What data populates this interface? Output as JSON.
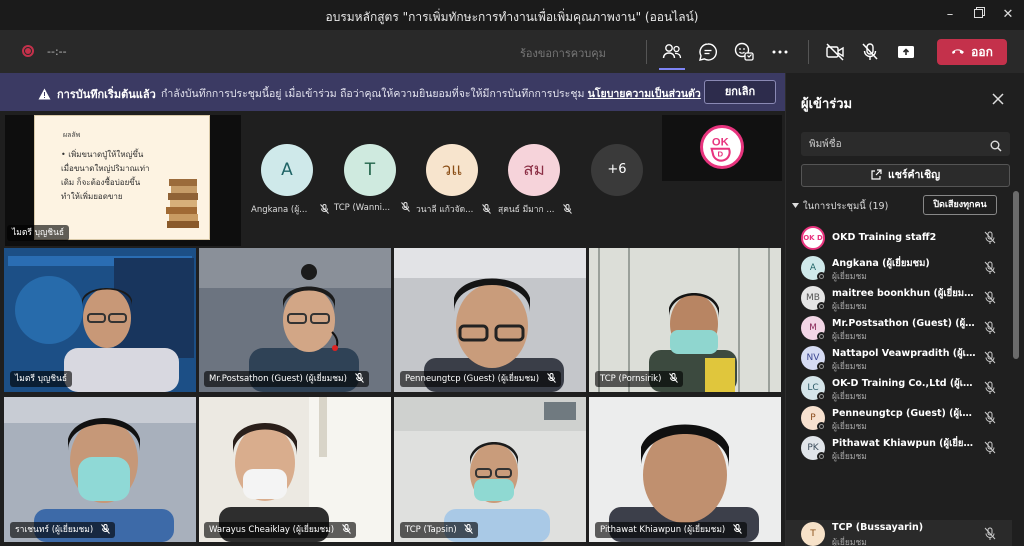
{
  "window": {
    "title": "อบรมหลักสูตร \"การเพิ่มทักษะการทำงานเพื่อเพิ่มคุณภาพงาน\" (ออนไลน์)"
  },
  "toolbar": {
    "timer": "--:--",
    "request_control": "ร้องขอการควบคุม",
    "leave_label": "ออก"
  },
  "banner": {
    "title": "การบันทึกเริ่มต้นแล้ว",
    "message": "กำลังบันทึกการประชุมนี้อยู่ เมื่อเข้าร่วม ถือว่าคุณให้ความยินยอมที่จะให้มีการบันทึกการประชุม",
    "link": "นโยบายความเป็นส่วนตัว",
    "cancel_label": "ยกเลิก"
  },
  "stage": {
    "share": {
      "presenter": "ไมตรี บุญชินธ์",
      "slide_heading": "ผลลัพ",
      "slide_lines": [
        "• เพิ่มขนาดปู่ให้ใหญ่ขึ้น",
        "เมื่อขนาดใหญ่ปริมาณเท่า",
        "เดิม ก็จะต้องซื้อบ่อยขึ้น",
        "ทำให้เพิ่มยอดขาย"
      ]
    },
    "avatars": [
      {
        "initials": "A",
        "name": "Angkana (ผู้...",
        "bg": "#cfe9ea",
        "fg": "#1f6466"
      },
      {
        "initials": "T",
        "name": "TCP (Wanni...",
        "bg": "#cfeadf",
        "fg": "#22644a"
      },
      {
        "initials": "วแ",
        "name": "วนาลี แก้วจัด...",
        "bg": "#f7e4cd",
        "fg": "#8a4d15"
      },
      {
        "initials": "สม",
        "name": "สุคนธ์ มีมาก ...",
        "bg": "#f6d3da",
        "fg": "#8b2f45"
      },
      {
        "initials": "+6",
        "name": "",
        "bg": "#3a3a3a",
        "fg": "#ffffff"
      }
    ],
    "okd_logo": "OK D",
    "tiles": [
      {
        "name": "ไมตรี บุญชินธ์"
      },
      {
        "name": "Mr.Postsathon (Guest) (ผู้เยี่ยมชม)"
      },
      {
        "name": "Penneungtcp (Guest) (ผู้เยี่ยมชม)"
      },
      {
        "name": "TCP (Pornsirik)"
      },
      {
        "name": "ราเชนทร์ (ผู้เยี่ยมชม)"
      },
      {
        "name": "Warayus Cheaiklay (ผู้เยี่ยมชม)"
      },
      {
        "name": "TCP (Tapsin)"
      },
      {
        "name": "Pithawat Khiawpun (ผู้เยี่ยมชม)"
      }
    ]
  },
  "panel": {
    "title": "ผู้เข้าร่วม",
    "search_placeholder": "พิมพ์ชื่อ",
    "share_invite_label": "แชร์คำเชิญ",
    "section_label": "ในการประชุมนี้ (19)",
    "mute_all_label": "ปิดเสียงทุกคน",
    "participants": [
      {
        "initials": "OK D",
        "name": "OKD Training staff2",
        "role": "",
        "bg": "#ffffff",
        "logo": true
      },
      {
        "initials": "A",
        "name": "Angkana (ผู้เยี่ยมชม)",
        "role": "ผู้เยี่ยมชม",
        "bg": "#cfe9ea"
      },
      {
        "initials": "MB",
        "name": "maitree boonkhun (ผู้เยี่ยมชม)",
        "role": "ผู้เยี่ยมชม",
        "bg": "#e5e5e5"
      },
      {
        "initials": "M",
        "name": "Mr.Postsathon (Guest) (ผู้เยี่ยมชม)",
        "role": "ผู้เยี่ยมชม",
        "bg": "#f3d6e6"
      },
      {
        "initials": "NV",
        "name": "Nattapol Veawpradith (ผู้เยี่ยมชม)",
        "role": "ผู้เยี่ยมชม",
        "bg": "#d6dcf4"
      },
      {
        "initials": "LC",
        "name": "OK-D Training Co.,Ltd (ผู้เยี่ยมชม)",
        "role": "ผู้เยี่ยมชม",
        "bg": "#d5e5ea"
      },
      {
        "initials": "P",
        "name": "Penneungtcp (Guest) (ผู้เยี่ยมชม)",
        "role": "ผู้เยี่ยมชม",
        "bg": "#f7e1cf"
      },
      {
        "initials": "PK",
        "name": "Pithawat Khiawpun (ผู้เยี่ยมชม)",
        "role": "ผู้เยี่ยมชม",
        "bg": "#e1e5ea"
      },
      {
        "initials": "T",
        "name": "TCP (Bussayarin)",
        "role": "ผู้เยี่ยมชม",
        "bg": "#f7e2c9"
      }
    ]
  },
  "colors": {
    "leave": "#c4314b",
    "banner": "#3b3a63",
    "accent": "#7f85f5"
  }
}
